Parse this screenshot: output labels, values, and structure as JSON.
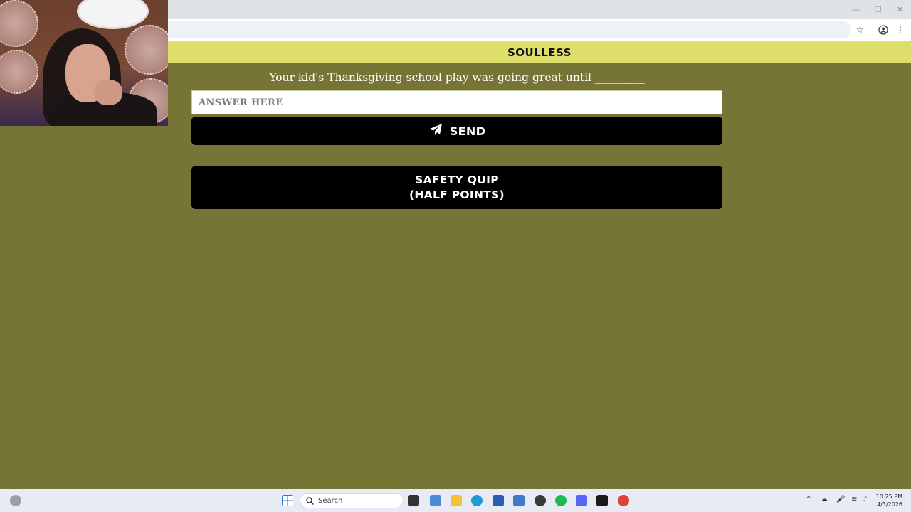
{
  "window": {
    "minimize": "—",
    "restore": "❐",
    "close": "✕"
  },
  "toolbar": {
    "bookmark_icon": "star-icon",
    "profile_icon": "profile-icon",
    "menu_icon": "kebab-menu-icon"
  },
  "game": {
    "title": "SOULLESS",
    "prompt": "Your kid's Thanksgiving school play was going great until _________",
    "answer_placeholder": "ANSWER HERE",
    "send_label": "SEND",
    "safety_line1": "SAFETY QUIP",
    "safety_line2": "(HALF POINTS)"
  },
  "colors": {
    "background": "#767535",
    "header": "#dede6c",
    "button": "#000000"
  },
  "taskbar": {
    "search_label": "Search",
    "time": "10:25 PM",
    "date": "4/3/2026"
  }
}
